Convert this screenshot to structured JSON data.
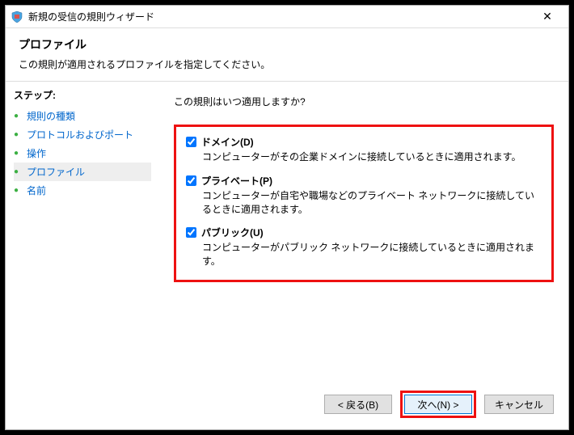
{
  "titlebar": {
    "title": "新規の受信の規則ウィザード"
  },
  "header": {
    "title": "プロファイル",
    "subtitle": "この規則が適用されるプロファイルを指定してください。"
  },
  "sidebar": {
    "title": "ステップ:",
    "items": [
      {
        "label": "規則の種類"
      },
      {
        "label": "プロトコルおよびポート"
      },
      {
        "label": "操作"
      },
      {
        "label": "プロファイル"
      },
      {
        "label": "名前"
      }
    ]
  },
  "main": {
    "question": "この規則はいつ適用しますか?",
    "options": [
      {
        "label": "ドメイン(D)",
        "desc": "コンピューターがその企業ドメインに接続しているときに適用されます。"
      },
      {
        "label": "プライベート(P)",
        "desc": "コンピューターが自宅や職場などのプライベート ネットワークに接続しているときに適用されます。"
      },
      {
        "label": "パブリック(U)",
        "desc": "コンピューターがパブリック ネットワークに接続しているときに適用されます。"
      }
    ]
  },
  "buttons": {
    "back": "< 戻る(B)",
    "next": "次へ(N) >",
    "cancel": "キャンセル"
  }
}
